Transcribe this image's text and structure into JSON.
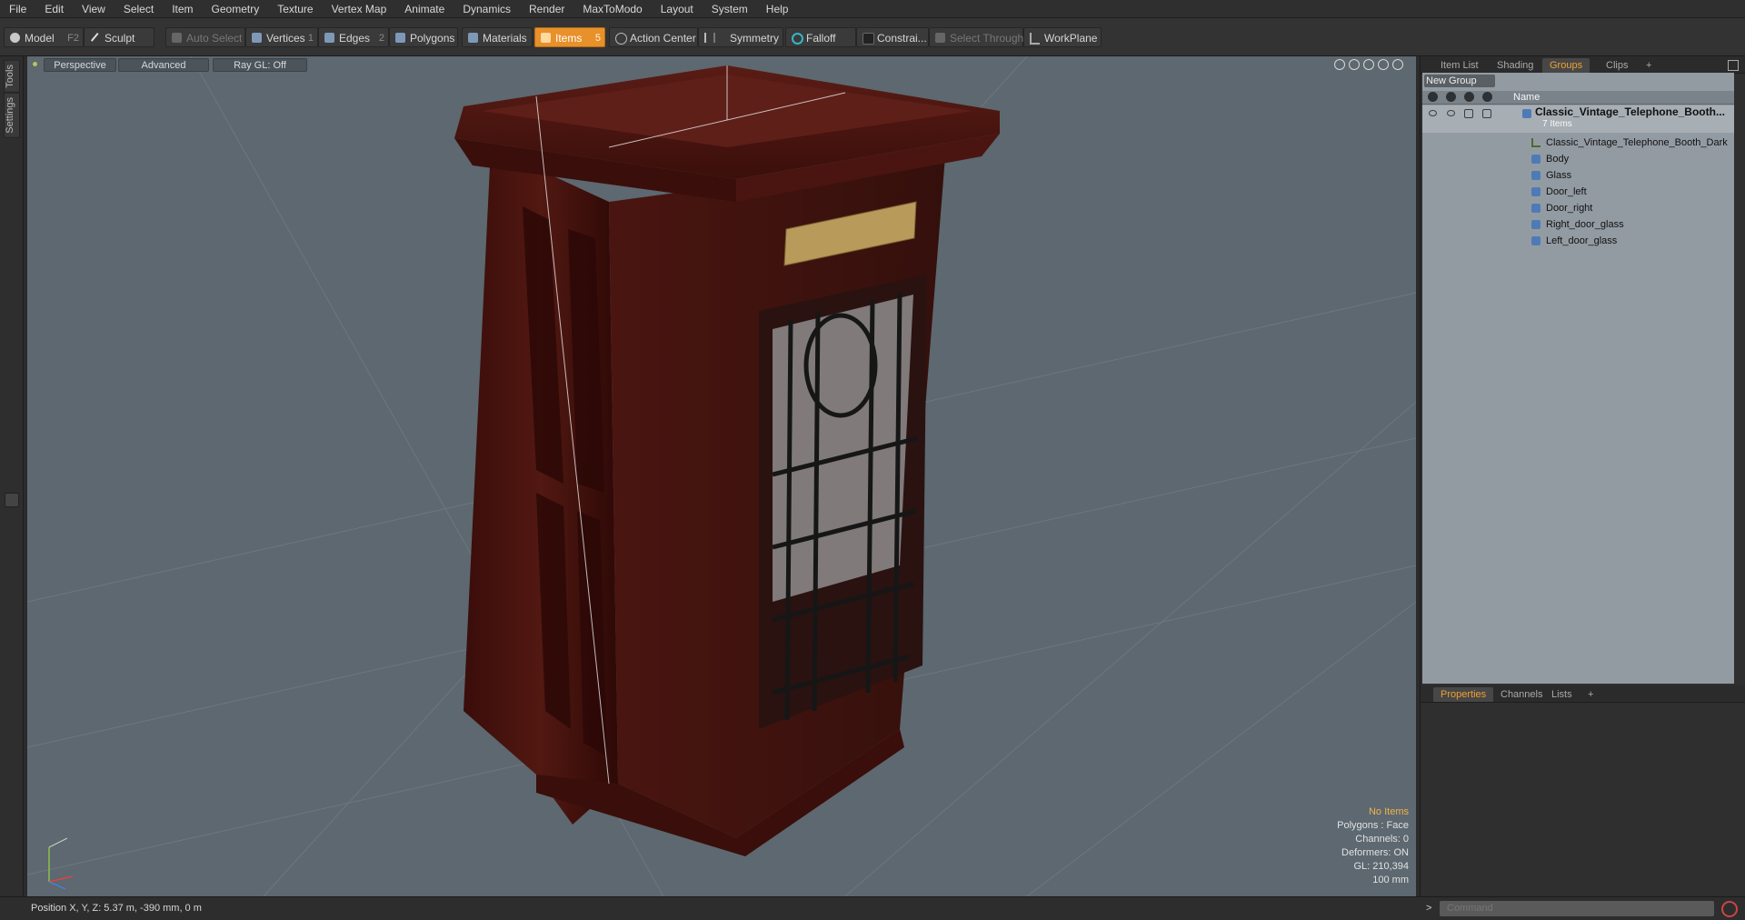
{
  "menu": [
    "File",
    "Edit",
    "View",
    "Select",
    "Item",
    "Geometry",
    "Texture",
    "Vertex Map",
    "Animate",
    "Dynamics",
    "Render",
    "MaxToModo",
    "Layout",
    "System",
    "Help"
  ],
  "toolbar": {
    "model": "Model",
    "model_shortcut": "F2",
    "sculpt": "Sculpt",
    "auto_select": "Auto Select",
    "vertices": "Vertices",
    "vertices_shortcut": "1",
    "edges": "Edges",
    "edges_shortcut": "2",
    "polygons": "Polygons",
    "materials": "Materials",
    "items": "Items",
    "items_shortcut": "5",
    "action_center": "Action Center",
    "symmetry": "Symmetry",
    "falloff": "Falloff",
    "constraints": "Constrai...",
    "select_through": "Select Through",
    "workplane": "WorkPlane"
  },
  "left_tabs": [
    "Tools",
    "Settings"
  ],
  "viewport": {
    "view_mode": "Perspective",
    "shading": "Advanced",
    "raygl": "Ray GL: Off",
    "readout": {
      "items": "No Items",
      "polygons": "Polygons : Face",
      "channels": "Channels: 0",
      "deformers": "Deformers: ON",
      "gl": "GL: 210,394",
      "grid": "100 mm"
    }
  },
  "right_panel": {
    "top_tabs": [
      "Item List",
      "Shading",
      "Groups",
      "Clips",
      "+"
    ],
    "active_top_tab": "Groups",
    "new_group": "New Group",
    "name_col": "Name",
    "group": {
      "name": "Classic_Vintage_Telephone_Booth...",
      "count": "7 Items",
      "children": [
        "Classic_Vintage_Telephone_Booth_Dark",
        "Body",
        "Glass",
        "Door_left",
        "Door_right",
        "Right_door_glass",
        "Left_door_glass"
      ]
    },
    "bottom_tabs": [
      "Properties",
      "Channels",
      "Lists",
      "+"
    ],
    "active_bottom_tab": "Properties"
  },
  "status": {
    "position": "Position X, Y, Z:  5.37 m, -390 mm, 0 m",
    "command_placeholder": "Command"
  },
  "colors": {
    "accent": "#e8902a",
    "viewport_bg": "#5d6870",
    "wood": "#4a1410"
  }
}
